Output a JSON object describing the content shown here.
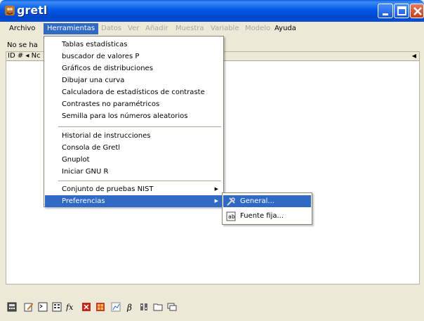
{
  "window": {
    "title": "gretl"
  },
  "menubar": {
    "items": [
      {
        "label": "Archivo",
        "mnemonic": "A",
        "state": "normal"
      },
      {
        "label": "Herramientas",
        "mnemonic": "t",
        "state": "active"
      },
      {
        "label": "Datos",
        "mnemonic": "",
        "state": "disabled"
      },
      {
        "label": "Ver",
        "mnemonic": "V",
        "state": "disabled"
      },
      {
        "label": "Añadir",
        "mnemonic": "ñ",
        "state": "disabled"
      },
      {
        "label": "Muestra",
        "mnemonic": "M",
        "state": "disabled"
      },
      {
        "label": "Variable",
        "mnemonic": "r",
        "state": "disabled"
      },
      {
        "label": "Modelo",
        "mnemonic": "o",
        "state": "disabled"
      },
      {
        "label": "Ayuda",
        "mnemonic": "u",
        "state": "normal"
      }
    ]
  },
  "status": {
    "text": "No se ha"
  },
  "list_header": {
    "text": "ID # ◂ Nc"
  },
  "herramientas_menu": {
    "groups": [
      [
        {
          "label": "Tablas estadísticas"
        },
        {
          "label": "buscador de valores P"
        },
        {
          "label": "Gráficos de distribuciones"
        },
        {
          "label": "Dibujar una curva"
        },
        {
          "label": "Calculadora de estadísticos de contraste"
        },
        {
          "label": "Contrastes no paramétricos"
        },
        {
          "label": "Semilla para los números aleatorios"
        }
      ],
      [
        {
          "label": "Historial de instrucciones"
        },
        {
          "label": "Consola de Gretl"
        },
        {
          "label": "Gnuplot"
        },
        {
          "label": "Iniciar GNU R"
        }
      ],
      [
        {
          "label": "Conjunto de pruebas NIST",
          "submenu": true
        },
        {
          "label": "Preferencias",
          "submenu": true,
          "active": true
        }
      ]
    ]
  },
  "preferencias_submenu": {
    "items": [
      {
        "label": "General...",
        "icon": "preferences-icon",
        "active": true
      },
      {
        "label": "Fuente fija...",
        "icon": "font-icon",
        "active": false
      }
    ]
  },
  "toolbar": {
    "icons": [
      "calculator-icon",
      "edit-icon",
      "terminal-icon",
      "session-icon",
      "function-icon",
      "pdf-icon",
      "grid-icon",
      "plot-icon",
      "beta-icon",
      "matrix-icon",
      "folder-icon",
      "windows-icon"
    ]
  },
  "colors": {
    "selection": "#316ac5",
    "menubar_bg": "#ece9d8",
    "titlebar": "#0058e6"
  }
}
